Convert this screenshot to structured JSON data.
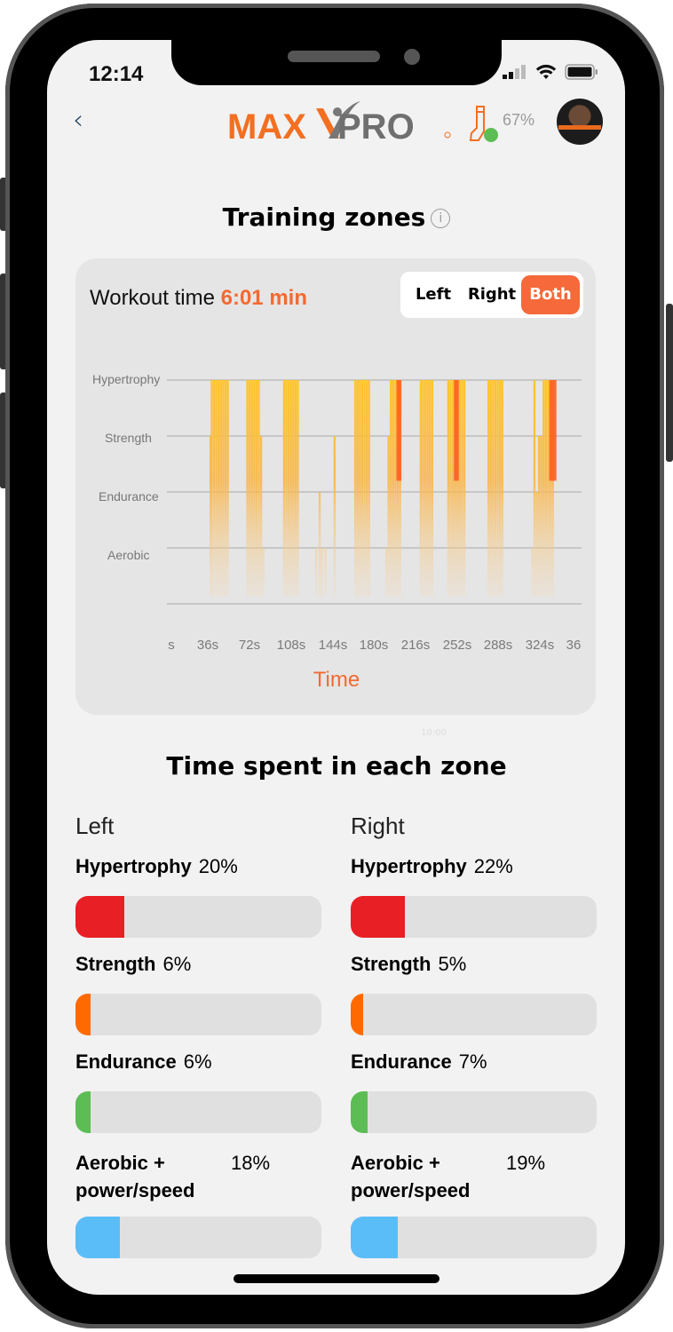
{
  "status_bar": {
    "time": "12:14"
  },
  "header": {
    "back_icon": "chevron-left-icon",
    "logo_text_orange": "MAX",
    "logo_text_gray": "PRO",
    "device_icon": "handle-device-icon",
    "device_connected": true,
    "device_battery": "67%",
    "avatar": "user-avatar"
  },
  "page": {
    "title": "Training zones",
    "info_icon": "info-icon"
  },
  "card": {
    "workout_label": "Workout time",
    "workout_value": "6:01 min",
    "segments": [
      {
        "label": "Left",
        "active": false
      },
      {
        "label": "Right",
        "active": false
      },
      {
        "label": "Both",
        "active": true
      }
    ]
  },
  "chart_data": {
    "type": "bar",
    "title": "",
    "xlabel": "Time",
    "ylabel": "",
    "y_categories": [
      "Aerobic",
      "Endurance",
      "Strength",
      "Hypertrophy"
    ],
    "ylim": [
      0,
      4
    ],
    "xlim_seconds": [
      0,
      361
    ],
    "x_tick_labels": [
      "s",
      "36s",
      "72s",
      "108s",
      "144s",
      "180s",
      "216s",
      "252s",
      "288s",
      "324s",
      "36"
    ],
    "grid": true,
    "bars": [
      {
        "t": 38,
        "level": 3
      },
      {
        "t": 39,
        "level": 4
      },
      {
        "t": 41,
        "level": 4
      },
      {
        "t": 43,
        "level": 4
      },
      {
        "t": 45,
        "level": 4
      },
      {
        "t": 47,
        "level": 4
      },
      {
        "t": 49,
        "level": 4
      },
      {
        "t": 51,
        "level": 4
      },
      {
        "t": 53,
        "level": 4
      },
      {
        "t": 70,
        "level": 4
      },
      {
        "t": 72,
        "level": 4
      },
      {
        "t": 74,
        "level": 4
      },
      {
        "t": 76,
        "level": 4
      },
      {
        "t": 78,
        "level": 4
      },
      {
        "t": 80,
        "level": 4
      },
      {
        "t": 82,
        "level": 3
      },
      {
        "t": 84,
        "level": 1
      },
      {
        "t": 102,
        "level": 4
      },
      {
        "t": 104,
        "level": 4
      },
      {
        "t": 106,
        "level": 4
      },
      {
        "t": 108,
        "level": 4
      },
      {
        "t": 110,
        "level": 4
      },
      {
        "t": 112,
        "level": 4
      },
      {
        "t": 114,
        "level": 4
      },
      {
        "t": 130,
        "level": 1
      },
      {
        "t": 133,
        "level": 2
      },
      {
        "t": 135,
        "level": 1
      },
      {
        "t": 138,
        "level": 1
      },
      {
        "t": 146,
        "level": 3
      },
      {
        "t": 164,
        "level": 4
      },
      {
        "t": 166,
        "level": 4
      },
      {
        "t": 168,
        "level": 4
      },
      {
        "t": 170,
        "level": 4
      },
      {
        "t": 172,
        "level": 4
      },
      {
        "t": 174,
        "level": 4
      },
      {
        "t": 176,
        "level": 4
      },
      {
        "t": 191,
        "level": 1
      },
      {
        "t": 193,
        "level": 3
      },
      {
        "t": 195,
        "level": 4
      },
      {
        "t": 197,
        "level": 4
      },
      {
        "t": 199,
        "level": 4
      },
      {
        "t": 201,
        "level": 4
      },
      {
        "t": 203,
        "level": 4
      },
      {
        "t": 221,
        "level": 4
      },
      {
        "t": 223,
        "level": 4
      },
      {
        "t": 225,
        "level": 4
      },
      {
        "t": 227,
        "level": 4
      },
      {
        "t": 229,
        "level": 4
      },
      {
        "t": 231,
        "level": 4
      },
      {
        "t": 245,
        "level": 4
      },
      {
        "t": 247,
        "level": 4
      },
      {
        "t": 249,
        "level": 4
      },
      {
        "t": 251,
        "level": 4
      },
      {
        "t": 253,
        "level": 4
      },
      {
        "t": 255,
        "level": 4
      },
      {
        "t": 257,
        "level": 4
      },
      {
        "t": 259,
        "level": 4
      },
      {
        "t": 280,
        "level": 4
      },
      {
        "t": 282,
        "level": 4
      },
      {
        "t": 284,
        "level": 4
      },
      {
        "t": 286,
        "level": 4
      },
      {
        "t": 288,
        "level": 4
      },
      {
        "t": 290,
        "level": 4
      },
      {
        "t": 292,
        "level": 4
      },
      {
        "t": 318,
        "level": 1
      },
      {
        "t": 320,
        "level": 4
      },
      {
        "t": 322,
        "level": 2
      },
      {
        "t": 324,
        "level": 3
      },
      {
        "t": 326,
        "level": 3
      },
      {
        "t": 328,
        "level": 4
      },
      {
        "t": 330,
        "level": 4
      },
      {
        "t": 332,
        "level": 4
      },
      {
        "t": 334,
        "level": 4
      },
      {
        "t": 336,
        "level": 4
      }
    ],
    "intense_bars_seconds": [
      201,
      203,
      251,
      253,
      334,
      336,
      338
    ]
  },
  "zones_section": {
    "title": "Time spent in each zone",
    "left": {
      "heading": "Left",
      "zones": [
        {
          "name": "Hypertrophy",
          "percent": "20%",
          "value": 20,
          "color": "#e82025"
        },
        {
          "name": "Strength",
          "percent": "6%",
          "value": 6,
          "color": "#ff6a00"
        },
        {
          "name": "Endurance",
          "percent": "6%",
          "value": 6,
          "color": "#5cbd55"
        },
        {
          "name": "Aerobic + power/speed",
          "percent": "18%",
          "value": 18,
          "color": "#5bbdf7"
        }
      ]
    },
    "right": {
      "heading": "Right",
      "zones": [
        {
          "name": "Hypertrophy",
          "percent": "22%",
          "value": 22,
          "color": "#e82025"
        },
        {
          "name": "Strength",
          "percent": "5%",
          "value": 5,
          "color": "#ff6a00"
        },
        {
          "name": "Endurance",
          "percent": "7%",
          "value": 7,
          "color": "#5cbd55"
        },
        {
          "name": "Aerobic + power/speed",
          "percent": "19%",
          "value": 19,
          "color": "#5bbdf7"
        }
      ]
    }
  },
  "faint_label": "10:00",
  "colors": {
    "accent": "#f26a32",
    "segment_active": "#f5693a"
  }
}
